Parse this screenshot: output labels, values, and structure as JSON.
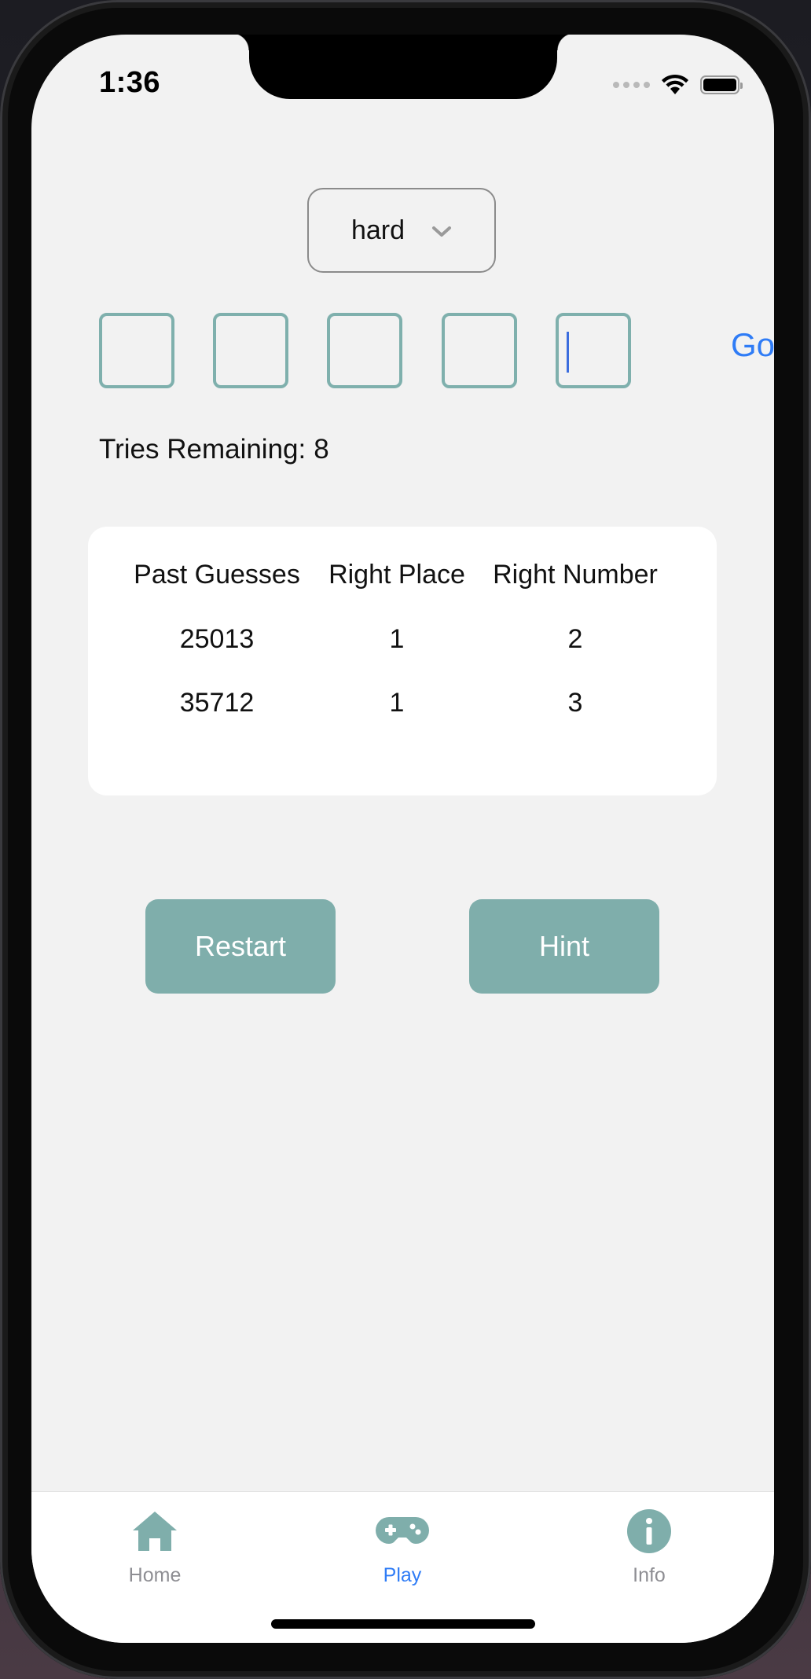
{
  "status_bar": {
    "time": "1:36"
  },
  "difficulty": {
    "selected": "hard"
  },
  "guess_inputs": [
    {
      "value": "",
      "focused": false
    },
    {
      "value": "",
      "focused": false
    },
    {
      "value": "",
      "focused": false
    },
    {
      "value": "",
      "focused": false
    },
    {
      "value": "",
      "focused": true
    }
  ],
  "go_label": "Go",
  "tries": {
    "label": "Tries Remaining:",
    "count": "8"
  },
  "history": {
    "headers": [
      "Past Guesses",
      "Right Place",
      "Right Number"
    ],
    "rows": [
      [
        "25013",
        "1",
        "2"
      ],
      [
        "35712",
        "1",
        "3"
      ]
    ]
  },
  "buttons": {
    "restart": "Restart",
    "hint": "Hint"
  },
  "tab_bar": {
    "items": [
      {
        "label": "Home",
        "icon": "home-icon",
        "active": false
      },
      {
        "label": "Play",
        "icon": "gamepad-icon",
        "active": true
      },
      {
        "label": "Info",
        "icon": "info-icon",
        "active": false
      }
    ]
  },
  "colors": {
    "accent": "#7faeab",
    "link_blue": "#2f7cf6",
    "background": "#f2f2f2"
  }
}
